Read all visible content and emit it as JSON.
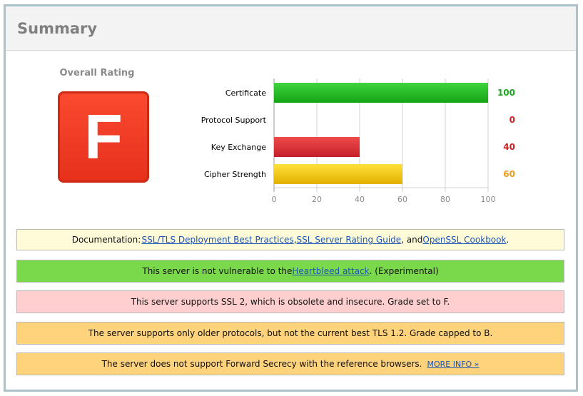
{
  "header": {
    "title": "Summary"
  },
  "overall": {
    "label": "Overall Rating",
    "grade": "F"
  },
  "colors": {
    "green": "#1fa61f",
    "red": "#cc2222",
    "orange": "#f09a1a"
  },
  "chart_data": {
    "type": "bar",
    "orientation": "horizontal",
    "categories": [
      "Certificate",
      "Protocol Support",
      "Key Exchange",
      "Cipher Strength"
    ],
    "values": [
      100,
      0,
      40,
      60
    ],
    "value_labels": [
      "100",
      "0",
      "40",
      "60"
    ],
    "bar_colors": [
      "green",
      "red",
      "red",
      "yellow"
    ],
    "xticks": [
      "0",
      "20",
      "40",
      "60",
      "80",
      "100"
    ],
    "xlim": [
      0,
      100
    ],
    "grid": true
  },
  "notices": {
    "documentation": {
      "prefix": "Documentation: ",
      "link1": "SSL/TLS Deployment Best Practices",
      "sep1": ", ",
      "link2": "SSL Server Rating Guide",
      "sep2": ", and ",
      "link3": "OpenSSL Cookbook",
      "suffix": "."
    },
    "heartbleed": {
      "prefix": "This server is not vulnerable to the ",
      "link": "Heartbleed attack",
      "suffix": ". (Experimental)"
    },
    "ssl2": {
      "text": "This server supports SSL 2, which is obsolete and insecure. Grade set to F."
    },
    "protocols": {
      "text": "The server supports only older protocols, but not the current best TLS 1.2. Grade capped to B."
    },
    "forward_secrecy": {
      "text": "The server does not support Forward Secrecy with the reference browsers.",
      "link": "MORE INFO »"
    }
  }
}
